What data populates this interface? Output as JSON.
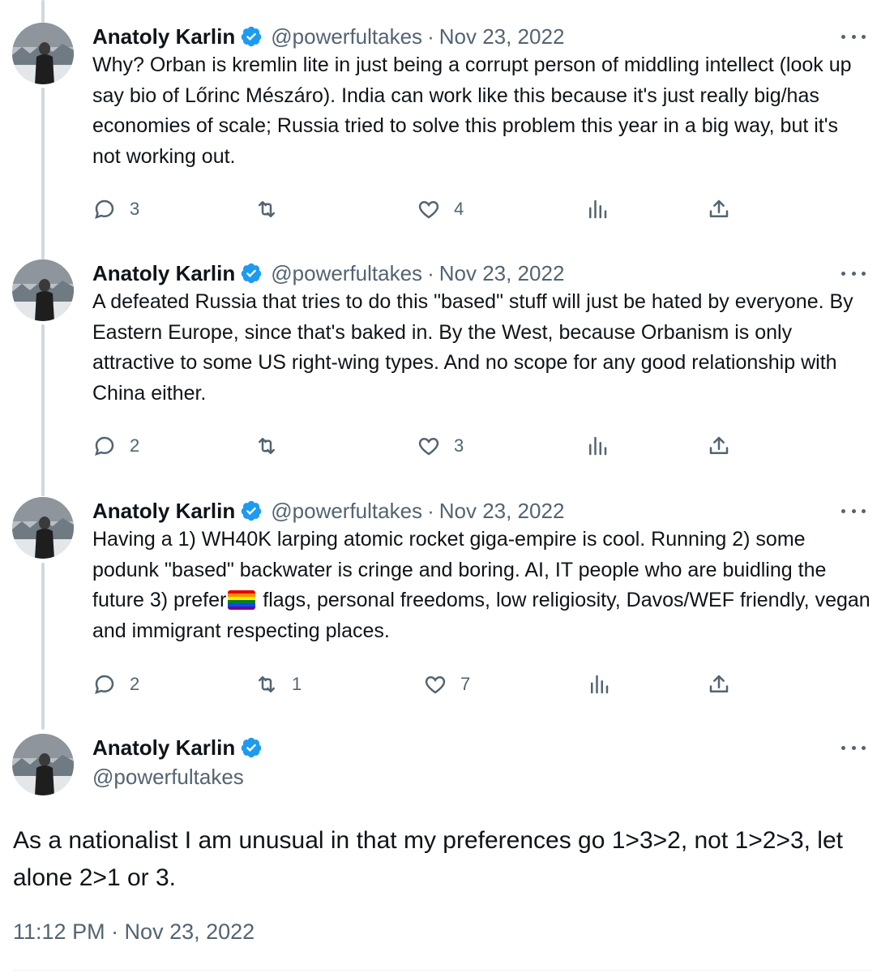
{
  "author": {
    "name": "Anatoly Karlin",
    "handle": "@powerfultakes"
  },
  "tweets": [
    {
      "date": "Nov 23, 2022",
      "text": "Why? Orban is kremlin lite in just being a corrupt person of middling intellect (look up say bio of Lőrinc Mészáro). India can work like this because it's just really big/has economies of scale; Russia tried to solve this problem this year in a big way, but it's not working out.",
      "replies": "3",
      "retweets": "",
      "likes": "4"
    },
    {
      "date": "Nov 23, 2022",
      "text": "A defeated Russia that tries to do this \"based\" stuff will just be hated by everyone. By Eastern Europe, since that's baked in. By the West, because Orbanism is only attractive to some US right-wing types. And no scope for any good relationship with China either.",
      "replies": "2",
      "retweets": "",
      "likes": "3"
    },
    {
      "date": "Nov 23, 2022",
      "text_before_flag": "Having a 1) WH40K larping atomic rocket giga-empire is cool. Running 2) some podunk \"based\" backwater is cringe and boring. AI, IT people who are buidling the future 3) prefer",
      "text_after_flag": " flags, personal freedoms, low religiosity, Davos/WEF friendly, vegan and immigrant respecting places.",
      "replies": "2",
      "retweets": "1",
      "likes": "7"
    }
  ],
  "main_tweet": {
    "text": "As a nationalist I am unusual in that my preferences go 1>3>2, not 1>2>3, let alone 2>1 or 3.",
    "timestamp": "11:12 PM · Nov 23, 2022"
  },
  "icons": {
    "reply": "reply-icon",
    "retweet": "retweet-icon",
    "like": "heart-icon",
    "views": "views-icon",
    "share": "share-icon",
    "verified": "verified-badge-icon",
    "more": "more-icon",
    "flag": "rainbow-flag-icon"
  },
  "colors": {
    "text": "#0f1419",
    "secondary": "#536471",
    "verified": "#1d9bf0",
    "thread_line": "#cfd9de"
  }
}
